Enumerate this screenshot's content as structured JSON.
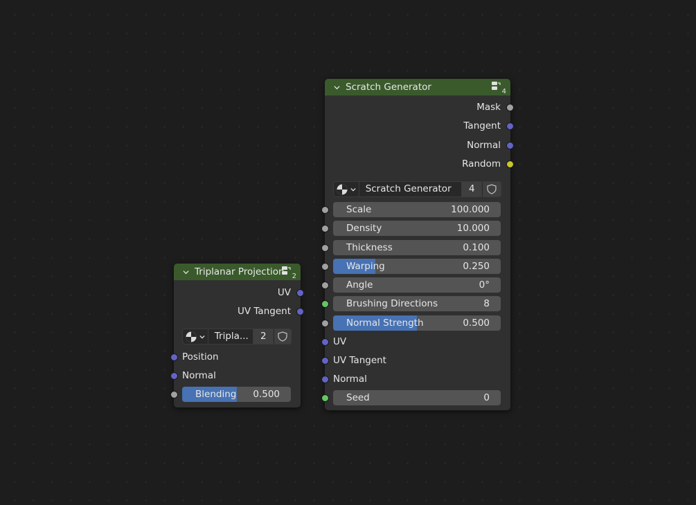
{
  "nodes": {
    "scratch": {
      "title": "Scratch Generator",
      "user_count": "4",
      "outputs": [
        "Mask",
        "Tangent",
        "Normal",
        "Random"
      ],
      "group": {
        "name": "Scratch Generator",
        "users": "4"
      },
      "fields": {
        "scale": {
          "label": "Scale",
          "value": "100.000"
        },
        "density": {
          "label": "Density",
          "value": "10.000"
        },
        "thickness": {
          "label": "Thickness",
          "value": "0.100"
        },
        "warping": {
          "label": "Warping",
          "value": "0.250",
          "fill": 0.25
        },
        "angle": {
          "label": "Angle",
          "value": "0°"
        },
        "brushing": {
          "label": "Brushing Directions",
          "value": "8"
        },
        "normal_strength": {
          "label": "Normal Strength",
          "value": "0.500",
          "fill": 0.5
        }
      },
      "inputs": [
        "UV",
        "UV Tangent",
        "Normal"
      ],
      "seed": {
        "label": "Seed",
        "value": "0"
      }
    },
    "triplanar": {
      "title": "Triplanar Projection",
      "user_count": "2",
      "outputs": [
        "UV",
        "UV Tangent"
      ],
      "group": {
        "name": "Tripla...",
        "users": "2"
      },
      "inputs": [
        "Position",
        "Normal"
      ],
      "blending": {
        "label": "Blending",
        "value": "0.500",
        "fill": 0.5
      }
    }
  },
  "icons": {
    "header": "node-tree-icon",
    "group": "material-sphere-icon",
    "fake_user": "shield-icon",
    "collapse": "chevron-down-icon"
  },
  "colors": {
    "header": "#3a5a2c",
    "socket_float": "#a1a1a1",
    "socket_vector": "#6363c7",
    "socket_color": "#c7c729",
    "socket_int": "#63c763",
    "slider_fill": "#4772b3"
  }
}
